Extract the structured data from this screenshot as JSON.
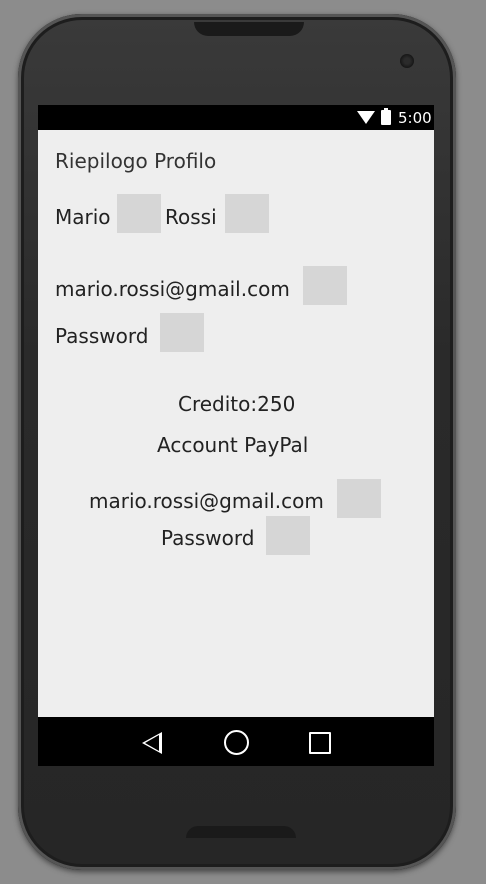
{
  "status_bar": {
    "time": "5:00",
    "icons": [
      "wifi-icon",
      "battery-icon"
    ]
  },
  "profile": {
    "title": "Riepilogo Profilo",
    "first_name": "Mario",
    "last_name": "Rossi",
    "email": "mario.rossi@gmail.com",
    "password_label": "Password"
  },
  "credit": {
    "label": "Credito:250"
  },
  "paypal": {
    "heading": "Account PayPal",
    "email": "mario.rossi@gmail.com",
    "password_label": "Password"
  },
  "nav_bar": {
    "icons": [
      "back-icon",
      "home-icon",
      "recents-icon"
    ]
  }
}
